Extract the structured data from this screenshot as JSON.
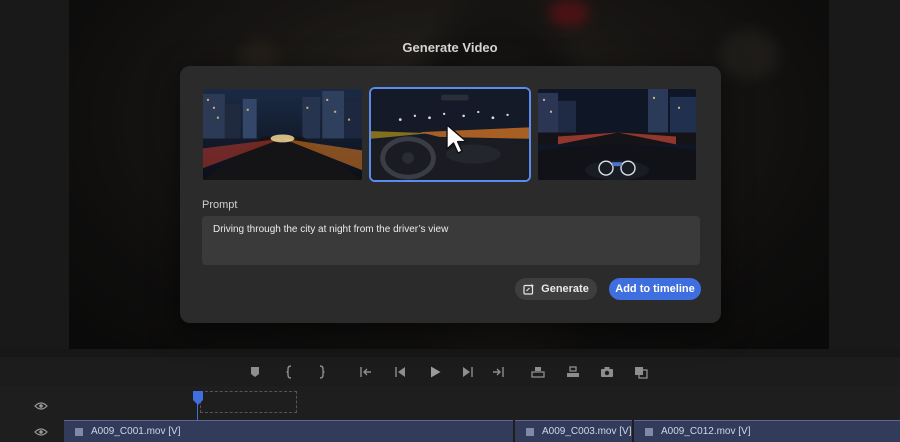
{
  "dialog": {
    "title": "Generate Video",
    "prompt_label": "Prompt",
    "prompt_value": "Driving through the city at night from the driver’s view",
    "generate_label": "Generate",
    "add_label": "Add to timeline",
    "selected_thumbnail": 2,
    "thumbnails": [
      {
        "icon": "city-street-night-thumbnail"
      },
      {
        "icon": "car-interior-night-thumbnail"
      },
      {
        "icon": "dashboard-city-night-thumbnail"
      }
    ]
  },
  "transport": {
    "buttons": [
      "marker-icon",
      "mark-in-icon",
      "mark-out-icon",
      "go-to-in-icon",
      "step-back-icon",
      "play-icon",
      "step-forward-icon",
      "go-to-out-icon",
      "lift-icon",
      "extract-icon",
      "export-frame-icon",
      "compare-icon"
    ]
  },
  "timeline": {
    "clips": [
      {
        "label": "A009_C001.mov [V]"
      },
      {
        "label": "A009_C003.mov [V]"
      },
      {
        "label": "A009_C012.mov [V]"
      }
    ]
  },
  "colors": {
    "accent": "#3f6fde",
    "selection_border": "#5a8bef",
    "dialog_bg": "#2b2b2c",
    "clip_bg": "#323c5a"
  }
}
